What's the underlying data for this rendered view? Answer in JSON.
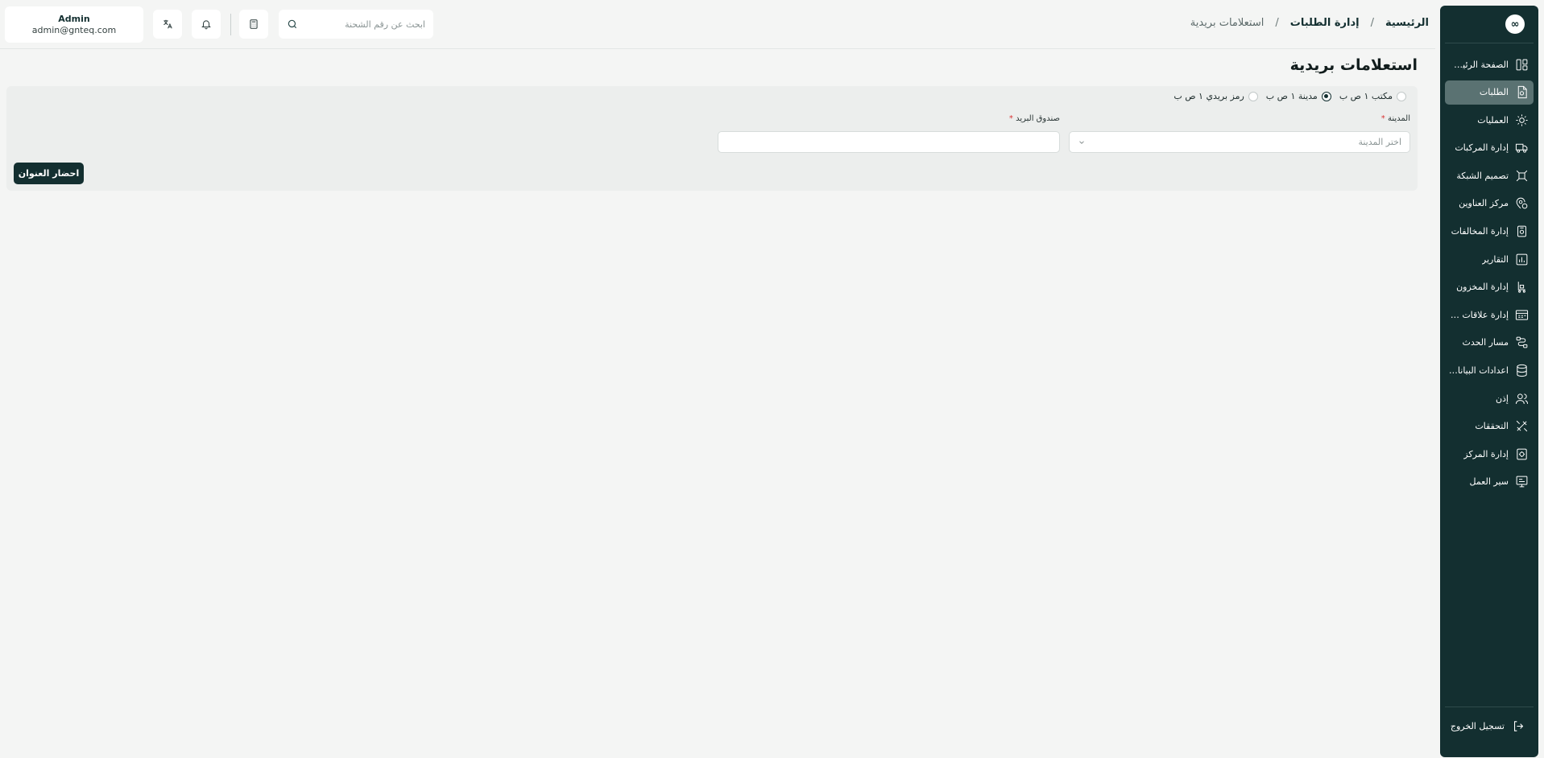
{
  "sidebar": {
    "logo": "∞",
    "items": [
      {
        "label": "الصفحة الرئيسية",
        "icon": "dashboard-icon",
        "active": false
      },
      {
        "label": "الطلبات",
        "icon": "orders-icon",
        "active": true
      },
      {
        "label": "العمليات",
        "icon": "operations-icon",
        "active": false
      },
      {
        "label": "إدارة المركبات",
        "icon": "truck-icon",
        "active": false
      },
      {
        "label": "تصميم الشبكة",
        "icon": "network-icon",
        "active": false
      },
      {
        "label": "مركز العناوين",
        "icon": "location-icon",
        "active": false
      },
      {
        "label": "إدارة المخالفات",
        "icon": "violations-icon",
        "active": false
      },
      {
        "label": "التقارير",
        "icon": "reports-icon",
        "active": false
      },
      {
        "label": "إدارة المخزون",
        "icon": "inventory-icon",
        "active": false
      },
      {
        "label": "إدارة علاقات العملاء",
        "icon": "crm-icon",
        "active": false
      },
      {
        "label": "مسار الحدث",
        "icon": "route-icon",
        "active": false
      },
      {
        "label": "اعدادات البيانات...",
        "icon": "database-icon",
        "active": false
      },
      {
        "label": "إذن",
        "icon": "users-icon",
        "active": false
      },
      {
        "label": "التحققات",
        "icon": "tools-icon",
        "active": false
      },
      {
        "label": "إدارة المركز",
        "icon": "center-icon",
        "active": false
      },
      {
        "label": "سير العمل",
        "icon": "workflow-icon",
        "active": false
      }
    ],
    "logout_label": "تسجيل الخروج"
  },
  "header": {
    "breadcrumb": {
      "home": "الرئيسية",
      "section": "إدارة الطلبات",
      "current": "استعلامات بريدية",
      "separator": "/"
    },
    "search_placeholder": "ابحث عن رقم الشحنة",
    "user": {
      "name": "Admin",
      "email": "admin@gnteq.com"
    }
  },
  "main": {
    "title": "استعلامات بريدية",
    "radio_options": [
      {
        "label": "مكتب ١ ص ب",
        "checked": false
      },
      {
        "label": "مدينة ١ ص ب",
        "checked": true
      },
      {
        "label": "رمز بريدي ١ ص ب",
        "checked": false
      }
    ],
    "city_label": "المدينة",
    "city_placeholder": "اختر المدينة",
    "pobox_label": "صندوق البريد",
    "pobox_value": "",
    "required_mark": "*",
    "submit_label": "احضار العنوان"
  },
  "colors": {
    "sidebar_bg": "#132f30",
    "active_item": "#5a7272",
    "page_bg": "#f4f5f4",
    "panel_bg": "#eceeed",
    "required": "#d93434"
  }
}
